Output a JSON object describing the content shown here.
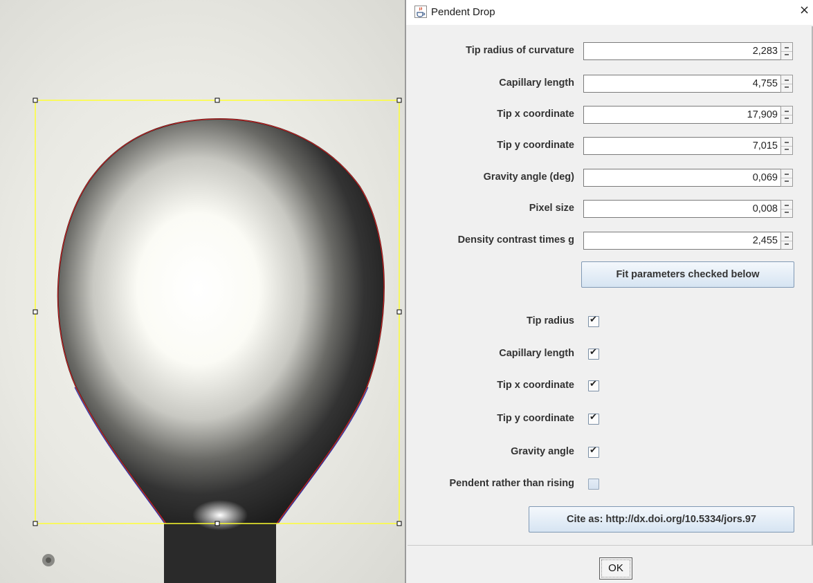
{
  "dialog": {
    "title": "Pendent Drop",
    "close_symbol": "×",
    "spinners": [
      {
        "label": "Tip radius of curvature",
        "value": "2,283"
      },
      {
        "label": "Capillary length",
        "value": "4,755"
      },
      {
        "label": "Tip x coordinate",
        "value": "17,909"
      },
      {
        "label": "Tip y coordinate",
        "value": "7,015"
      },
      {
        "label": "Gravity angle (deg)",
        "value": "0,069"
      },
      {
        "label": "Pixel size",
        "value": "0,008"
      },
      {
        "label": "Density contrast times g",
        "value": "2,455"
      }
    ],
    "fit_button": "Fit parameters checked below",
    "checkboxes": [
      {
        "label": "Tip radius",
        "checked": true
      },
      {
        "label": "Capillary length",
        "checked": true
      },
      {
        "label": "Tip x coordinate",
        "checked": true
      },
      {
        "label": "Tip y coordinate",
        "checked": true
      },
      {
        "label": "Gravity angle",
        "checked": true
      },
      {
        "label": "Pendent rather than rising",
        "checked": false
      }
    ],
    "checkmark": "✔",
    "cite_button": "Cite as: http://dx.doi.org/10.5334/jors.97",
    "ok_button": "OK"
  },
  "colors": {
    "roi_yellow": "#ffff33",
    "fit_red": "#cc2222",
    "fit_blue": "#2222aa",
    "button_blue": "#d6e4f2"
  },
  "icons": [
    "java-cup-icon",
    "close-icon",
    "spinner-up-icon",
    "spinner-down-icon",
    "checkmark-icon"
  ]
}
